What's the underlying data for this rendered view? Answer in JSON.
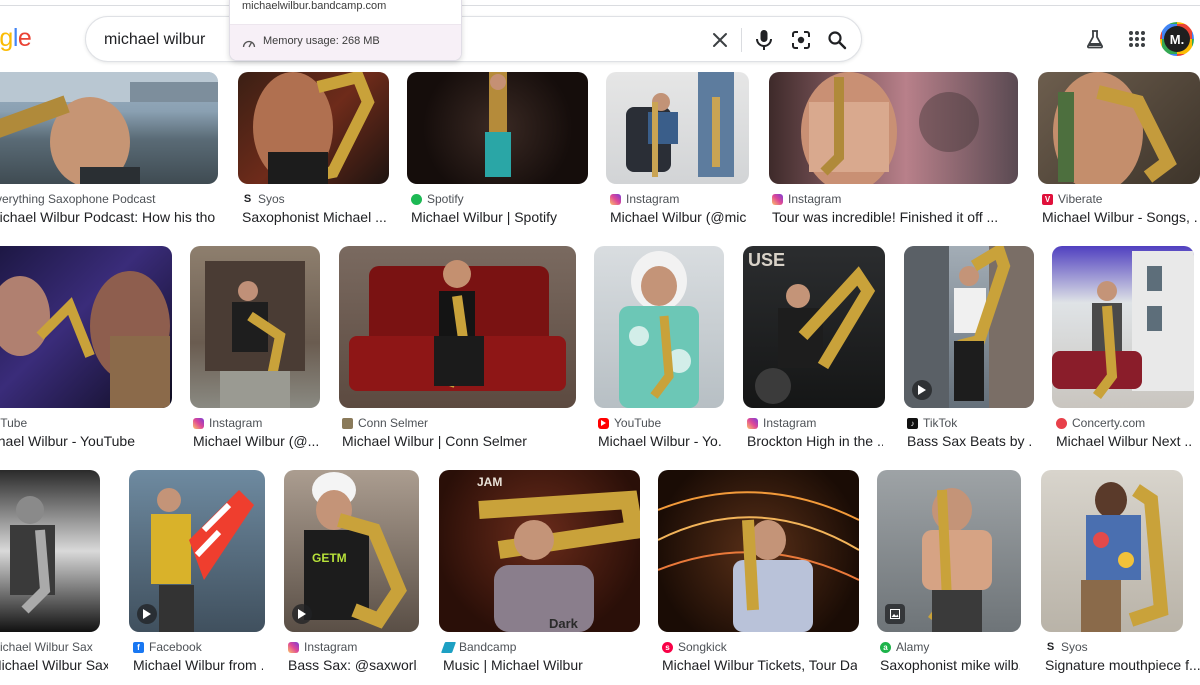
{
  "header": {
    "logo_partial": "ogle",
    "search_value": "michael wilbur",
    "avatar_initials": "M."
  },
  "tab_popup": {
    "url": "michaelwilbur.bandcamp.com",
    "memory": "Memory usage: 268 MB"
  },
  "results": [
    {
      "source": "Everything Saxophone Podcast",
      "title": "Michael Wilbur Podcast: How his thought ...",
      "favicon": "generic"
    },
    {
      "source": "Syos",
      "title": "Saxophonist Michael ...",
      "favicon": "syos"
    },
    {
      "source": "Spotify",
      "title": "Michael Wilbur | Spotify",
      "favicon": "spotify"
    },
    {
      "source": "Instagram",
      "title": "Michael Wilbur (@mic...",
      "favicon": "instagram"
    },
    {
      "source": "Instagram",
      "title": "Tour was incredible! Finished it off ...",
      "favicon": "instagram"
    },
    {
      "source": "Viberate",
      "title": "Michael Wilbur - Songs, ...",
      "favicon": "viberate"
    },
    {
      "source": "YouTube",
      "title": "Michael Wilbur - YouTube",
      "favicon": "youtube"
    },
    {
      "source": "Instagram",
      "title": "Michael Wilbur (@...",
      "favicon": "instagram"
    },
    {
      "source": "Conn Selmer",
      "title": "Michael Wilbur | Conn Selmer",
      "favicon": "connselmer"
    },
    {
      "source": "YouTube",
      "title": "Michael Wilbur - Yo...",
      "favicon": "youtube"
    },
    {
      "source": "Instagram",
      "title": "Brockton High in the ...",
      "favicon": "instagram"
    },
    {
      "source": "TikTok",
      "title": "Bass Sax Beats by ...",
      "favicon": "tiktok"
    },
    {
      "source": "Concerty.com",
      "title": "Michael Wilbur Next ...",
      "favicon": "concerty"
    },
    {
      "source": "Michael Wilbur Sax",
      "title": "Michael Wilbur Sax",
      "favicon": "generic"
    },
    {
      "source": "Facebook",
      "title": "Michael Wilbur from ...",
      "favicon": "facebook"
    },
    {
      "source": "Instagram",
      "title": "Bass Sax: @saxworl...",
      "favicon": "instagram"
    },
    {
      "source": "Bandcamp",
      "title": "Music | Michael Wilbur",
      "favicon": "bandcamp"
    },
    {
      "source": "Songkick",
      "title": "Michael Wilbur Tickets, Tour Da...",
      "favicon": "songkick"
    },
    {
      "source": "Alamy",
      "title": "Saxophonist mike wilb...",
      "favicon": "alamy"
    },
    {
      "source": "Syos",
      "title": "Signature mouthpiece f...",
      "favicon": "syos"
    }
  ],
  "colors": {
    "google_blue": "#4285f4",
    "google_red": "#ea4335",
    "google_yellow": "#fbbc05",
    "google_green": "#34a853",
    "text_primary": "#202124",
    "text_secondary": "#4d5156"
  }
}
